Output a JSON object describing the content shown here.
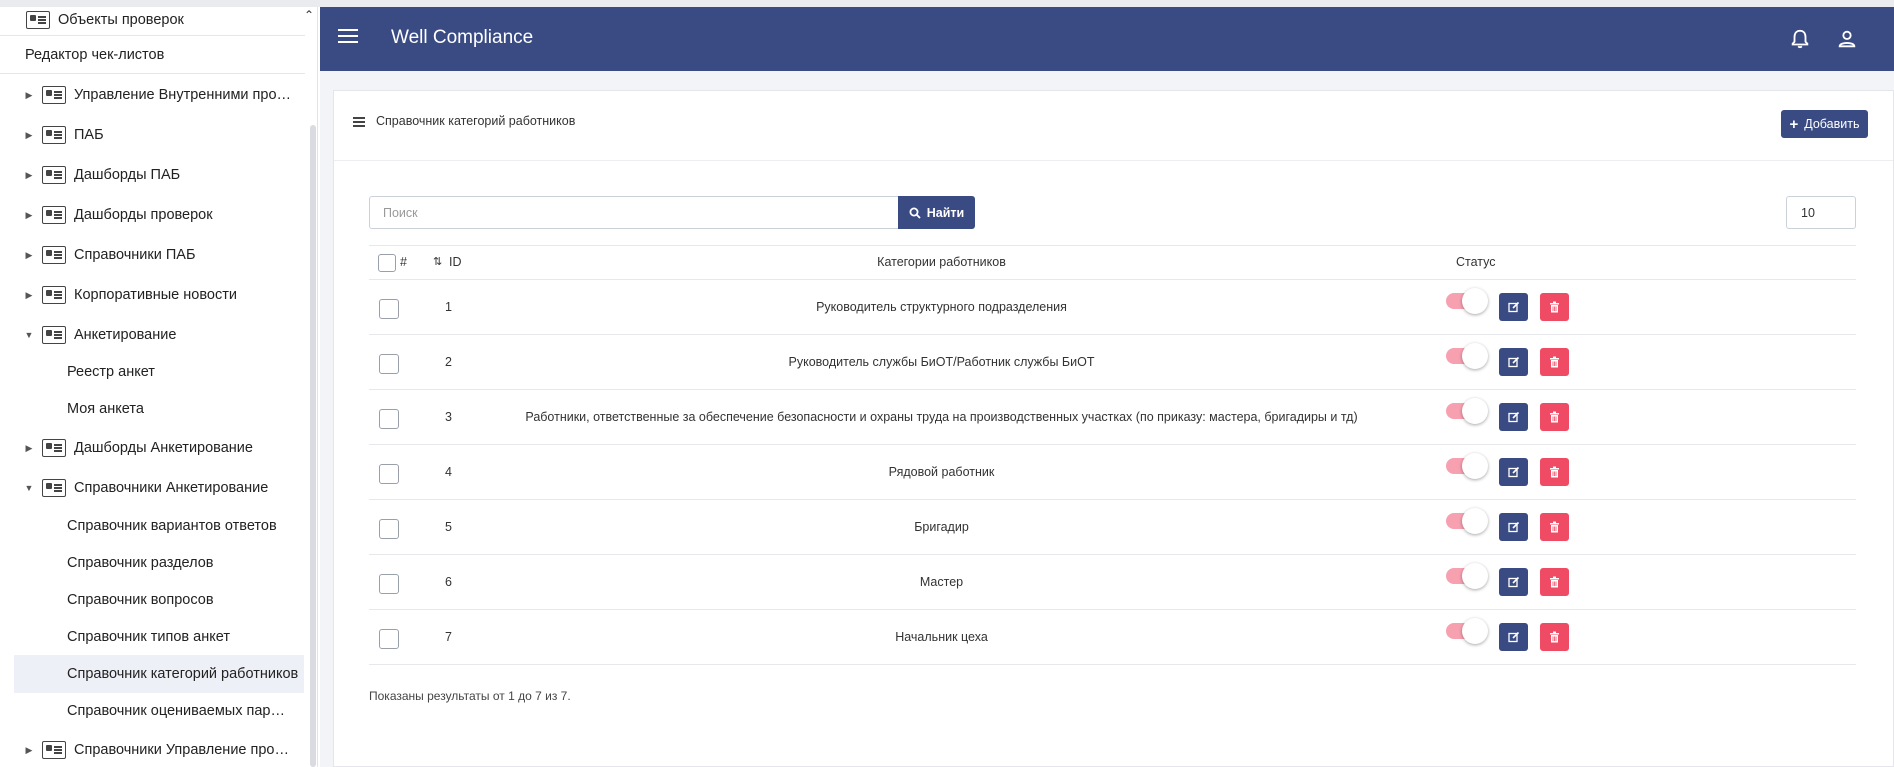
{
  "header": {
    "app_title": "Well Compliance"
  },
  "sidebar": {
    "top_item": "Объекты проверок",
    "editor_item": "Редактор чек-листов",
    "items": [
      {
        "label": "Управление Внутренними проверками"
      },
      {
        "label": "ПАБ"
      },
      {
        "label": "Дашборды ПАБ"
      },
      {
        "label": "Дашборды проверок"
      },
      {
        "label": "Справочники ПАБ"
      },
      {
        "label": "Корпоративные новости"
      },
      {
        "label": "Анкетирование"
      },
      {
        "label": "Реестр анкет"
      },
      {
        "label": "Моя анкета"
      },
      {
        "label": "Дашборды Анкетирование"
      },
      {
        "label": "Справочники Анкетирование"
      },
      {
        "label": "Справочник вариантов ответов"
      },
      {
        "label": "Справочник разделов"
      },
      {
        "label": "Справочник вопросов"
      },
      {
        "label": "Справочник типов анкет"
      },
      {
        "label": "Справочник категорий работников"
      },
      {
        "label": "Справочник оцениваемых параметров"
      },
      {
        "label": "Справочники Управление производственной безопасностью"
      }
    ]
  },
  "page": {
    "title": "Справочник категорий работников",
    "add_label": "Добавить",
    "search_placeholder": "Поиск",
    "search_label": "Найти",
    "page_size": "10"
  },
  "table": {
    "columns": {
      "hash": "#",
      "id": "ID",
      "category": "Категории работников",
      "status": "Статус"
    },
    "rows": [
      {
        "id": "1",
        "category": "Руководитель структурного подразделения",
        "active": true
      },
      {
        "id": "2",
        "category": "Руководитель службы БиОТ/Работник службы БиОТ",
        "active": true
      },
      {
        "id": "3",
        "category": "Работники, ответственные за обеспечение безопасности и охраны труда на производственных участках (по приказу: мастера, бригадиры и тд)",
        "active": true
      },
      {
        "id": "4",
        "category": "Рядовой работник",
        "active": true
      },
      {
        "id": "5",
        "category": "Бригадир",
        "active": true
      },
      {
        "id": "6",
        "category": "Мастер",
        "active": true
      },
      {
        "id": "7",
        "category": "Начальник цеха",
        "active": true
      }
    ]
  },
  "footer": {
    "results_text": "Показаны результаты от 1 до 7 из 7."
  },
  "colors": {
    "primary": "#3a4b84",
    "danger": "#f04b64",
    "toggle_track": "#f6a0b0"
  }
}
